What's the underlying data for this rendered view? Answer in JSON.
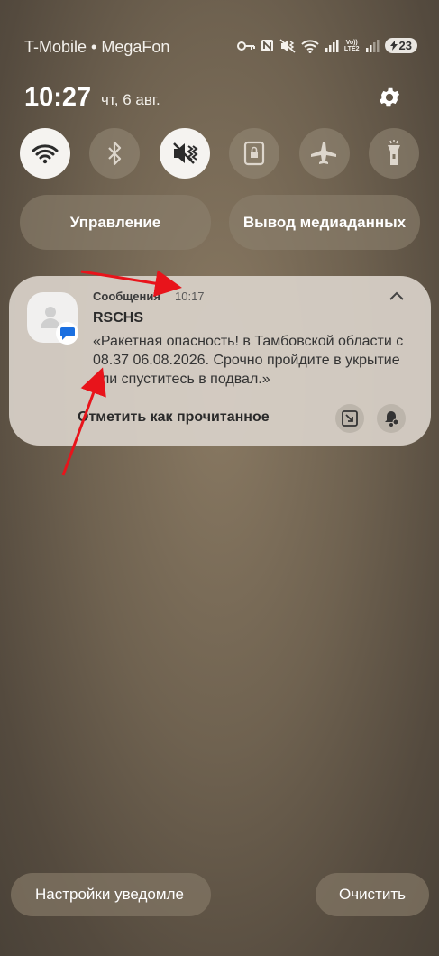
{
  "status_bar": {
    "carrier": "T-Mobile • MegaFon",
    "icons": [
      "key-icon",
      "nfc-icon",
      "vibrate-mute-icon",
      "wifi-icon",
      "signal-icon",
      "volte-lte-icon",
      "signal-weak-icon"
    ],
    "volte_label": "Vo))\nLTE2",
    "battery": "23"
  },
  "header": {
    "time": "10:27",
    "date": "чт, 6 авг."
  },
  "quick_toggles": [
    {
      "icon": "wifi-icon",
      "state": "on"
    },
    {
      "icon": "bluetooth-icon",
      "state": "off"
    },
    {
      "icon": "vibrate-mute-icon",
      "state": "on"
    },
    {
      "icon": "screen-lock-icon",
      "state": "off"
    },
    {
      "icon": "airplane-icon",
      "state": "off"
    },
    {
      "icon": "flashlight-icon",
      "state": "off"
    }
  ],
  "pills": {
    "control": "Управление",
    "media": "Вывод медиаданных"
  },
  "notification": {
    "app_name": "Сообщения",
    "time": "10:17",
    "sender": "RSCHS",
    "body": "«Ракетная опасность! в Тамбовской области с 08.37 06.08.2026. Срочно пройдите в укрытие или спуститесь в подвал.»",
    "action_mark_read": "Отметить как прочитанное"
  },
  "bottom": {
    "notification_settings": "Настройки уведомле",
    "clear": "Очистить"
  },
  "colors": {
    "annotation_arrow": "#e8141b",
    "toggle_on": "#f5f3f0",
    "toggle_off": "#968a78"
  }
}
